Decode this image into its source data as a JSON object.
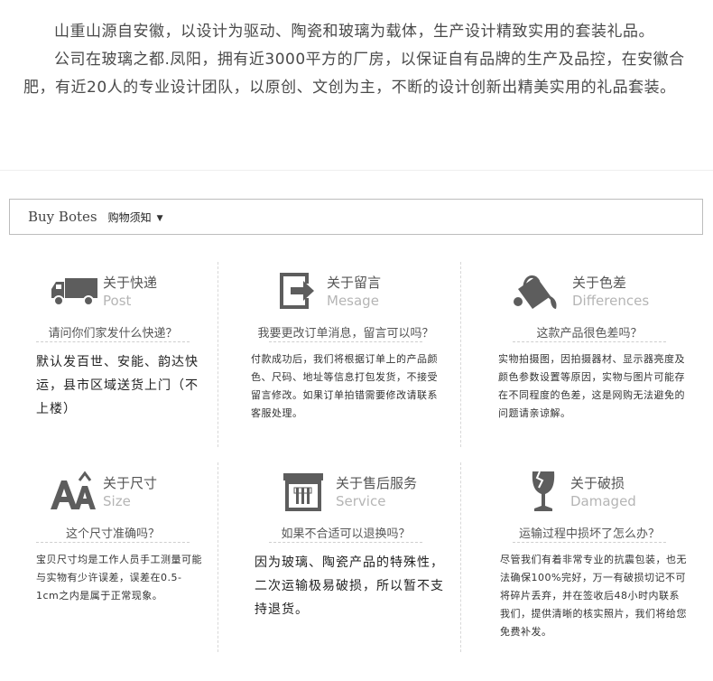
{
  "intro": {
    "p1": "山重山源自安徽，以设计为驱动、陶瓷和玻璃为载体，生产设计精致实用的套装礼品。",
    "p2": "公司在玻璃之都.凤阳，拥有近3000平方的厂房，以保证自有品牌的生产及品控，在安徽合肥，有近20人的专业设计团队，以原创、文创为主，不断的设计创新出精美实用的礼品套装。"
  },
  "notice": {
    "en": "Buy Botes",
    "zh": "购物须知",
    "caret": "▼"
  },
  "cards": [
    {
      "title": "关于快递",
      "sub": "Post",
      "icon": "truck-icon",
      "question": "请问你们家发什么快递？",
      "answer": "默认发百世、安能、韵达快运，县市区域送货上门（不上楼）"
    },
    {
      "title": "关于留言",
      "sub": "Mesage",
      "icon": "message-arrow-icon",
      "question": "我要更改订单消息，留言可以吗？",
      "answer": "付款成功后，我们将根据订单上的产品颜色、尺码、地址等信息打包发货，不接受留言修改。如果订单拍错需要修改请联系客服处理。"
    },
    {
      "title": "关于色差",
      "sub": "Differences",
      "icon": "paint-bucket-icon",
      "question": "这款产品很色差吗？",
      "answer": "实物拍摄图，因拍摄器材、显示器亮度及颜色参数设置等原因，实物与图片可能存在不同程度的色差，这是网购无法避免的问题请亲谅解。"
    },
    {
      "title": "关于尺寸",
      "sub": "Size",
      "icon": "font-size-icon",
      "question": "这个尺寸准确吗？",
      "answer": "宝贝尺寸均是工作人员手工测量可能与实物有少许误差，误差在0.5-1cm之内是属于正常现象。"
    },
    {
      "title": "关于售后服务",
      "sub": "Service",
      "icon": "service-box-icon",
      "question": "如果不合适可以退换吗？",
      "answer": "因为玻璃、陶瓷产品的特殊性，二次运输极易破损，所以暂不支持退货。"
    },
    {
      "title": "关于破损",
      "sub": "Damaged",
      "icon": "broken-glass-icon",
      "question": "运输过程中损坏了怎么办？",
      "answer": "尽管我们有着非常专业的抗震包装，也无法确保100%完好，万一有破损切记不可将碎片丢弃，并在签收后48小时内联系我们，提供清晰的核实照片，我们将给您免费补发。"
    }
  ],
  "colors": {
    "icon": "#5d5d5d",
    "title": "#555555",
    "sub": "#b5b5b5",
    "border": "#bcbcbc"
  }
}
